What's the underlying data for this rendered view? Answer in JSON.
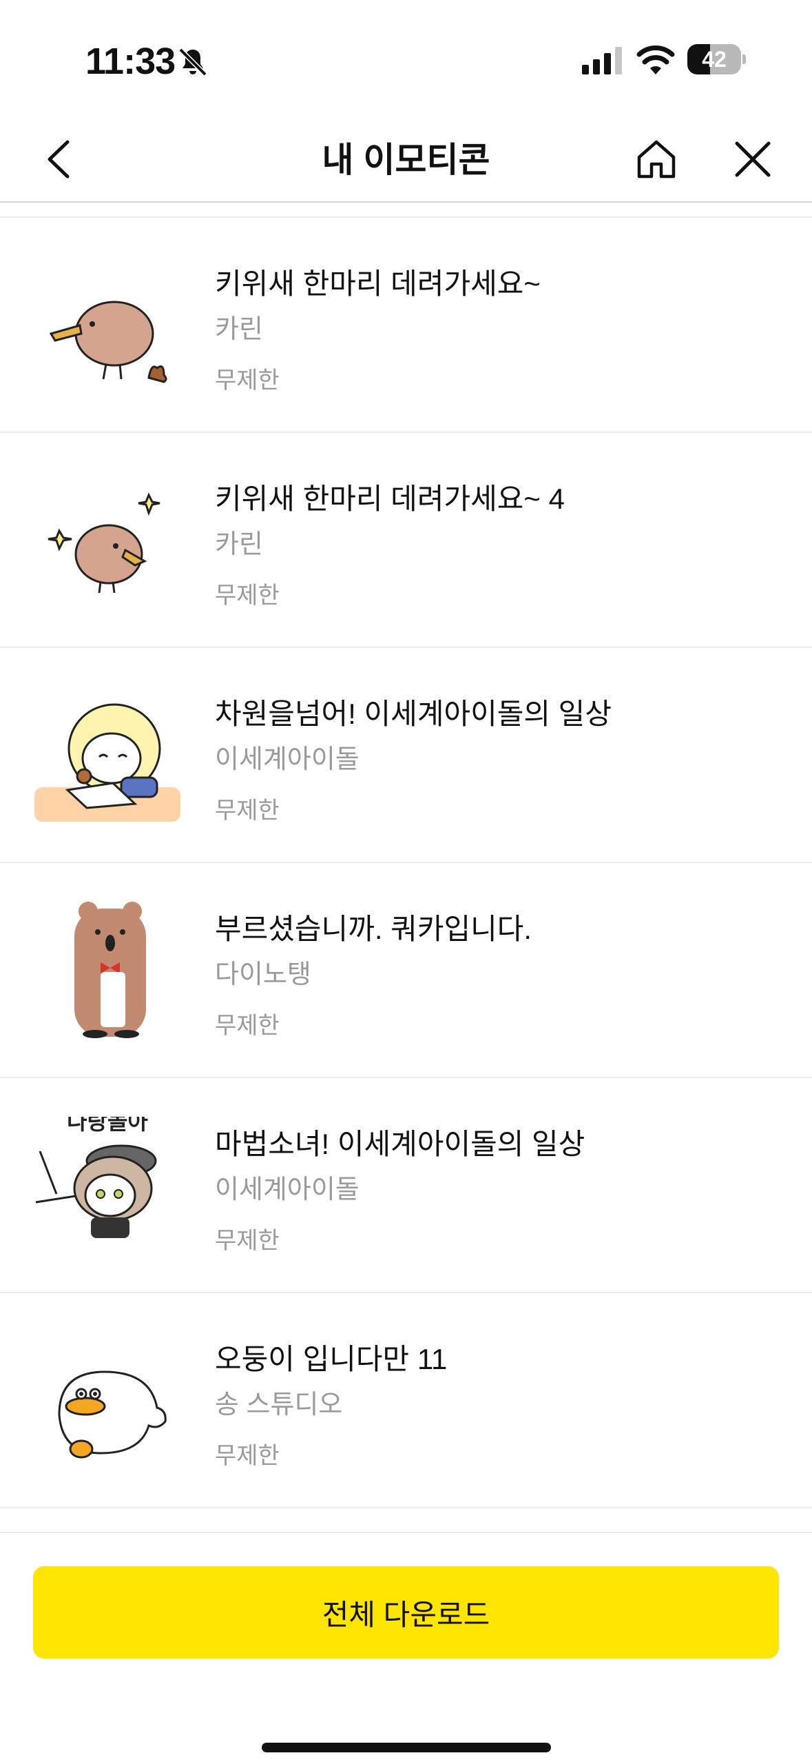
{
  "status_bar": {
    "time": "11:33",
    "battery_level": "42",
    "battery_fraction": 0.42,
    "icons": [
      "bell-slash-icon",
      "cellular-signal-icon",
      "wifi-icon",
      "battery-icon"
    ]
  },
  "header": {
    "title": "내 이모티콘",
    "icons": [
      "back-chevron-icon",
      "home-icon",
      "close-icon"
    ]
  },
  "emoticons": [
    {
      "title": "키위새 한마리 데려가세요~",
      "author": "카린",
      "term": "무제한",
      "thumb_icon": "kiwi-bird-icon"
    },
    {
      "title": "키위새 한마리 데려가세요~ 4",
      "author": "카린",
      "term": "무제한",
      "thumb_icon": "kiwi-bird-sparkle-icon"
    },
    {
      "title": "차원을넘어! 이세계아이돌의 일상",
      "author": "이세계아이돌",
      "term": "무제한",
      "thumb_icon": "blonde-girl-reading-icon"
    },
    {
      "title": "부르셨습니까. 쿼카입니다.",
      "author": "다이노탱",
      "term": "무제한",
      "thumb_icon": "quokka-butler-icon"
    },
    {
      "title": "마법소녀! 이세계아이돌의 일상",
      "author": "이세계아이돌",
      "term": "무제한",
      "thumb_icon": "girl-beret-icon"
    },
    {
      "title": "오둥이 입니다만 11",
      "author": "송 스튜디오",
      "term": "무제한",
      "thumb_icon": "white-duck-icon"
    }
  ],
  "sticker_text": {
    "play_with_me": "나랑놀아"
  },
  "footer": {
    "download_all_label": "전체 다운로드"
  },
  "colors": {
    "accent_yellow": "#fee500",
    "muted_text": "#9a9a9a"
  }
}
